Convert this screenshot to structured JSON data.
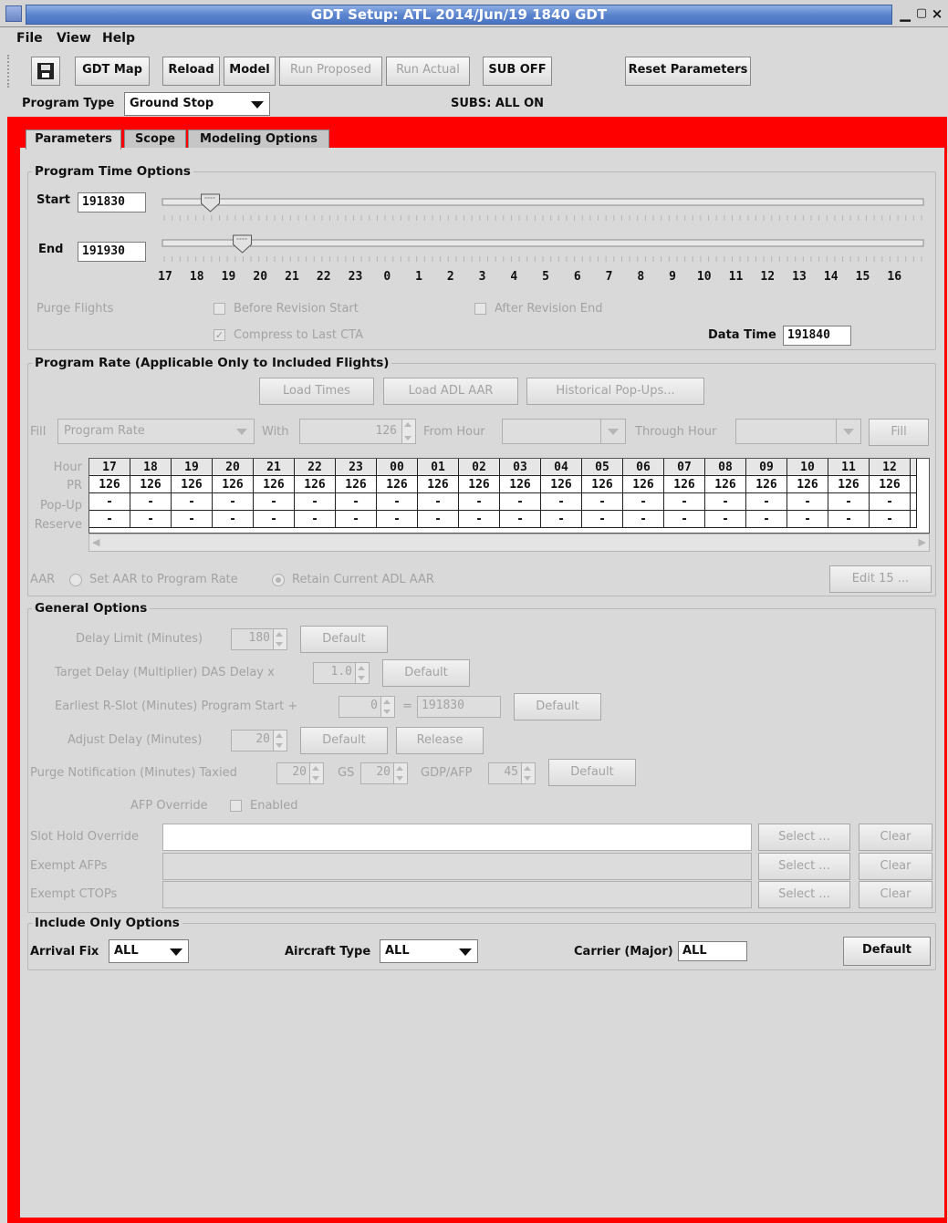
{
  "window": {
    "title": "GDT Setup: ATL 2014/Jun/19 1840 GDT"
  },
  "menu": {
    "file": "File",
    "view": "View",
    "help": "Help"
  },
  "toolbar": {
    "gdt_map": "GDT Map",
    "reload": "Reload",
    "model": "Model",
    "run_proposed": "Run Proposed",
    "run_actual": "Run Actual",
    "sub_off": "SUB OFF",
    "reset_parameters": "Reset Parameters"
  },
  "program_type": {
    "label": "Program Type",
    "value": "Ground Stop"
  },
  "subs_status": "SUBS: ALL ON",
  "tabs": [
    "Parameters",
    "Scope",
    "Modeling Options"
  ],
  "time_options": {
    "title": "Program Time Options",
    "start_label": "Start",
    "start_value": "191830",
    "end_label": "End",
    "end_value": "191930",
    "hours": [
      "17",
      "18",
      "19",
      "20",
      "21",
      "22",
      "23",
      "0",
      "1",
      "2",
      "3",
      "4",
      "5",
      "6",
      "7",
      "8",
      "9",
      "10",
      "11",
      "12",
      "13",
      "14",
      "15",
      "16"
    ],
    "start_slider_fraction": 0.063,
    "end_slider_fraction": 0.105,
    "purge_flights": "Purge Flights",
    "before_revision_start": "Before Revision Start",
    "after_revision_end": "After Revision End",
    "compress_last_cta": "Compress to Last CTA",
    "data_time_label": "Data Time",
    "data_time_value": "191840"
  },
  "program_rate": {
    "title": "Program Rate (Applicable Only to Included Flights)",
    "load_times": "Load Times",
    "load_adl_aar": "Load ADL AAR",
    "historical_popups": "Historical Pop-Ups...",
    "fill_label": "Fill",
    "fill_value": "Program Rate",
    "with_label": "With",
    "with_value": "126",
    "from_hour": "From Hour",
    "through_hour": "Through Hour",
    "fill_button": "Fill",
    "row_labels": [
      "Hour",
      "PR",
      "Pop-Up",
      "Reserve"
    ],
    "hours": [
      "17",
      "18",
      "19",
      "20",
      "21",
      "22",
      "23",
      "00",
      "01",
      "02",
      "03",
      "04",
      "05",
      "06",
      "07",
      "08",
      "09",
      "10",
      "11",
      "12"
    ],
    "pr": [
      "126",
      "126",
      "126",
      "126",
      "126",
      "126",
      "126",
      "126",
      "126",
      "126",
      "126",
      "126",
      "126",
      "126",
      "126",
      "126",
      "126",
      "126",
      "126",
      "126"
    ],
    "popup": [
      "-",
      "-",
      "-",
      "-",
      "-",
      "-",
      "-",
      "-",
      "-",
      "-",
      "-",
      "-",
      "-",
      "-",
      "-",
      "-",
      "-",
      "-",
      "-",
      "-"
    ],
    "reserve": [
      "-",
      "-",
      "-",
      "-",
      "-",
      "-",
      "-",
      "-",
      "-",
      "-",
      "-",
      "-",
      "-",
      "-",
      "-",
      "-",
      "-",
      "-",
      "-",
      "-"
    ],
    "aar_label": "AAR",
    "set_aar": "Set AAR to Program Rate",
    "retain_aar": "Retain Current ADL AAR",
    "edit_button": "Edit 15 ..."
  },
  "general": {
    "title": "General Options",
    "delay_limit": "Delay Limit (Minutes)",
    "delay_limit_value": "180",
    "target_delay": "Target Delay (Multiplier) DAS Delay x",
    "target_delay_value": "1.0",
    "earliest_rslot": "Earliest R-Slot (Minutes) Program Start +",
    "earliest_value": "0",
    "earliest_eq": "=",
    "earliest_time": "191830",
    "adjust_delay": "Adjust Delay (Minutes)",
    "adjust_value": "20",
    "purge_notification": "Purge Notification (Minutes) Taxied",
    "taxied_value": "20",
    "gs_label": "GS",
    "gs_value": "20",
    "gdp_afp_label": "GDP/AFP",
    "gdp_afp_value": "45",
    "default": "Default",
    "release": "Release",
    "afp_override": "AFP Override",
    "enabled": "Enabled",
    "slot_hold_override": "Slot Hold Override",
    "exempt_afps": "Exempt AFPs",
    "exempt_ctops": "Exempt CTOPs",
    "select": "Select ...",
    "clear": "Clear"
  },
  "include_only": {
    "title": "Include Only Options",
    "arrival_fix_label": "Arrival Fix",
    "arrival_fix_value": "ALL",
    "aircraft_type_label": "Aircraft Type",
    "aircraft_type_value": "ALL",
    "carrier_label": "Carrier (Major)",
    "carrier_value": "ALL",
    "default": "Default"
  },
  "colors": {
    "frame": "#ff0000",
    "title_bar": "#5c85cf",
    "panel": "#d9d9d9"
  },
  "icons": {
    "app": "window-app-icon",
    "save": "floppy-disk-icon"
  }
}
